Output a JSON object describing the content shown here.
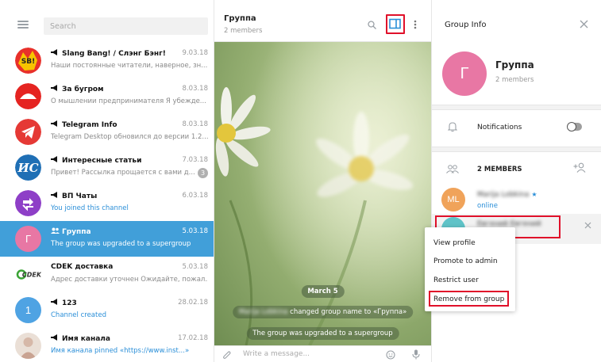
{
  "sidebar": {
    "search_placeholder": "Search",
    "chats": [
      {
        "title": "Slang Bang! / Слэнг Бэнг!",
        "date": "9.03.18",
        "preview": "Наши постоянные читатели, наверное, зн...",
        "channel": true
      },
      {
        "title": "За бугром",
        "date": "8.03.18",
        "preview": "О мышлении предпринимателя  Я убежде...",
        "channel": true
      },
      {
        "title": "Telegram Info",
        "date": "8.03.18",
        "preview": "Telegram Desktop обновился до версии 1.2....",
        "channel": true
      },
      {
        "title": "Интересные статьи",
        "date": "7.03.18",
        "preview": "Привет! Рассылка прощается с вами д...",
        "channel": true,
        "unread": "3"
      },
      {
        "title": "ВП Чаты",
        "date": "6.03.18",
        "preview": "You joined this channel",
        "channel": true
      },
      {
        "title": "Группа",
        "date": "5.03.18",
        "preview": "The group was upgraded to a supergroup",
        "active": true,
        "avatar_letter": "Г"
      },
      {
        "title": "CDEK доставка",
        "date": "5.03.18",
        "preview": "Адрес доставки уточнен Ожидайте, пожал..."
      },
      {
        "title": "123",
        "date": "28.02.18",
        "preview": "Channel created",
        "channel": true,
        "avatar_letter": "1"
      },
      {
        "title": "Имя канала",
        "date": "17.02.18",
        "preview": "Имя канала pinned «https://www.inst...»",
        "channel": true
      }
    ]
  },
  "chat": {
    "title": "Группа",
    "subtitle": "2 members",
    "date_pill": "March 5",
    "service_msg_1_name": "Marija Lobkina",
    "service_msg_1": " changed group name to «Группа»",
    "service_msg_2": "The group was upgraded to a supergroup",
    "input_placeholder": "Write a message..."
  },
  "group_info": {
    "title": "Group Info",
    "avatar_letter": "Г",
    "name": "Группа",
    "members_count": "2 members",
    "notifications_label": "Notifications",
    "members_header": "2 MEMBERS",
    "members": [
      {
        "initials": "ML",
        "name": "Marija Lobkina",
        "status": "online",
        "color": "#f0a35a"
      },
      {
        "initials": "",
        "name": "Евгений Евгений",
        "status": "",
        "color": "#5fc3c8"
      }
    ]
  },
  "context_menu": {
    "items": [
      "View profile",
      "Promote to admin",
      "Restrict user",
      "Remove from group"
    ]
  },
  "colors": {
    "accent": "#419fd9",
    "highlight_red": "#e0102a",
    "link_blue": "#2b8fd8"
  }
}
